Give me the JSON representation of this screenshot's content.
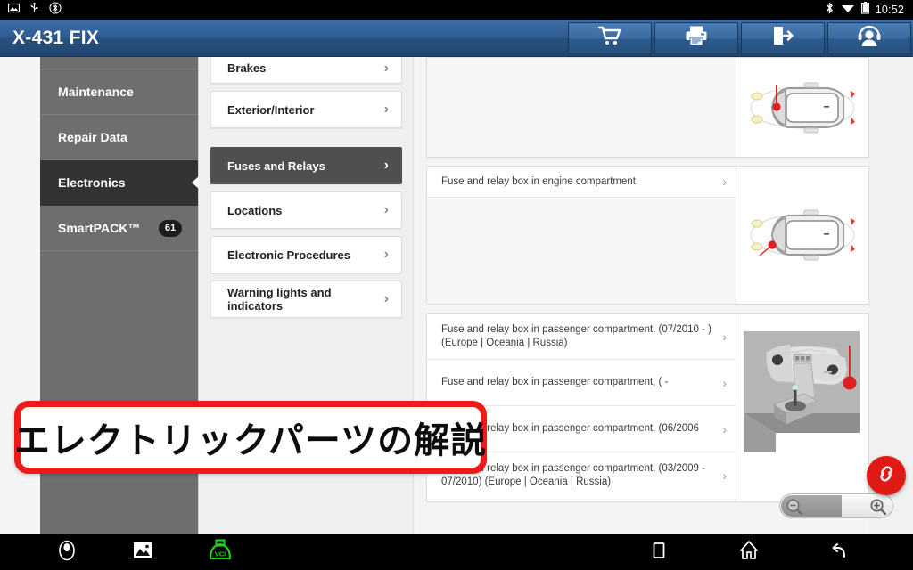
{
  "statusbar": {
    "time": "10:52",
    "left_icons": [
      "image-icon",
      "usb-icon",
      "bluetooth-settings-icon"
    ],
    "right_icons": [
      "bluetooth-icon",
      "wifi-icon",
      "battery-icon"
    ]
  },
  "header": {
    "brand": "X-431 FIX",
    "buttons": [
      {
        "name": "cart-button",
        "icon": "shopping-cart-icon"
      },
      {
        "name": "print-button",
        "icon": "printer-icon"
      },
      {
        "name": "exit-button",
        "icon": "exit-door-icon"
      },
      {
        "name": "support-button",
        "icon": "headset-user-icon"
      }
    ]
  },
  "sidebar": {
    "items": [
      {
        "label": "Maintenance",
        "active": false,
        "badge": ""
      },
      {
        "label": "Repair Data",
        "active": false,
        "badge": ""
      },
      {
        "label": "Electronics",
        "active": true,
        "badge": ""
      },
      {
        "label": "SmartPACK™",
        "active": false,
        "badge": "61"
      }
    ]
  },
  "menu": {
    "items": [
      {
        "label": "Brakes",
        "selected": false
      },
      {
        "label": "Exterior/Interior",
        "selected": false
      },
      {
        "label": "Fuses and Relays",
        "selected": true
      },
      {
        "label": "Locations",
        "selected": false
      },
      {
        "label": "Electronic Procedures",
        "selected": false
      },
      {
        "label": "Warning lights and indicators",
        "selected": false
      }
    ]
  },
  "main": {
    "cards": [
      {
        "name": "result-card-1",
        "rows": [],
        "thumb": "car-top-view-front-left-marker"
      },
      {
        "name": "result-card-2",
        "rows": [
          {
            "label": "Fuse and relay box in engine compartment"
          }
        ],
        "thumb": "car-top-view-front-left-marker"
      },
      {
        "name": "result-card-3",
        "rows": [
          {
            "label": "Fuse and relay box in passenger compartment, (07/2010 - ) (Europe | Oceania | Russia)"
          },
          {
            "label": "Fuse and relay box in passenger compartment, ( -"
          },
          {
            "label": "Fuse and relay box in passenger compartment, (06/2006"
          },
          {
            "label": "Fuse and relay box in passenger compartment, (03/2009 - 07/2010) (Europe | Oceania | Russia)"
          }
        ],
        "thumb": "dashboard-console-3d-marker"
      }
    ]
  },
  "controls": {
    "link_fab": "chain-link-icon",
    "zoom_out": "magnifier-minus-icon",
    "zoom_in": "magnifier-plus-icon"
  },
  "annotation": {
    "text": "エレクトリックパーツの解説",
    "border_color": "#ee1b1b"
  },
  "navbar": {
    "items": [
      {
        "name": "nav-browser",
        "icon": "browser-icon"
      },
      {
        "name": "nav-gallery",
        "icon": "gallery-image-icon"
      },
      {
        "name": "nav-vci",
        "icon": "vci-connector-icon",
        "label": "VCI"
      },
      {
        "name": "nav-recents",
        "icon": "recents-square-icon"
      },
      {
        "name": "nav-home",
        "icon": "home-icon"
      },
      {
        "name": "nav-back",
        "icon": "back-arrow-icon"
      }
    ]
  },
  "colors": {
    "header_blue": "#2f5d93",
    "sidebar_gray": "#6e6e6e",
    "sidebar_active": "#333333",
    "menu_selected": "#4f4f4f",
    "accent_red": "#e01b16",
    "vci_green": "#22cc22"
  }
}
